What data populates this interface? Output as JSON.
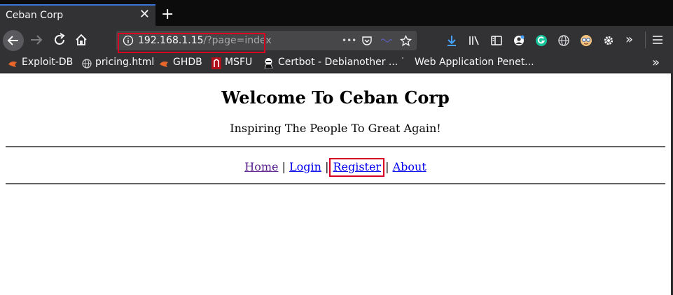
{
  "browser": {
    "tab_title": "Ceban Corp",
    "tab_close": "✕",
    "new_tab": "+",
    "url_host": "192.168.1.15",
    "url_path": "/?page=index",
    "more_actions": "•••",
    "overflow": "»"
  },
  "bookmarks": [
    {
      "label": "Exploit-DB",
      "icon": "exploit-db-icon"
    },
    {
      "label": "pricing.html",
      "icon": "globe-icon"
    },
    {
      "label": "GHDB",
      "icon": "ghdb-icon"
    },
    {
      "label": "MSFU",
      "icon": "msfu-icon"
    },
    {
      "label": "Certbot - Debianother ...",
      "icon": "certbot-icon"
    },
    {
      "label": "Web Application Penet...",
      "icon": "web-page-icon"
    }
  ],
  "page": {
    "title": "Welcome To Ceban Corp",
    "tagline": "Inspiring The People To Great Again!",
    "nav": {
      "home": "Home",
      "login": "Login",
      "register": "Register",
      "about": "About",
      "separator": "|"
    }
  },
  "colors": {
    "highlight_box": "#d70022",
    "link": "#0000ee",
    "visited_link": "#551a8b",
    "tab_accent": "#3b73d4"
  }
}
